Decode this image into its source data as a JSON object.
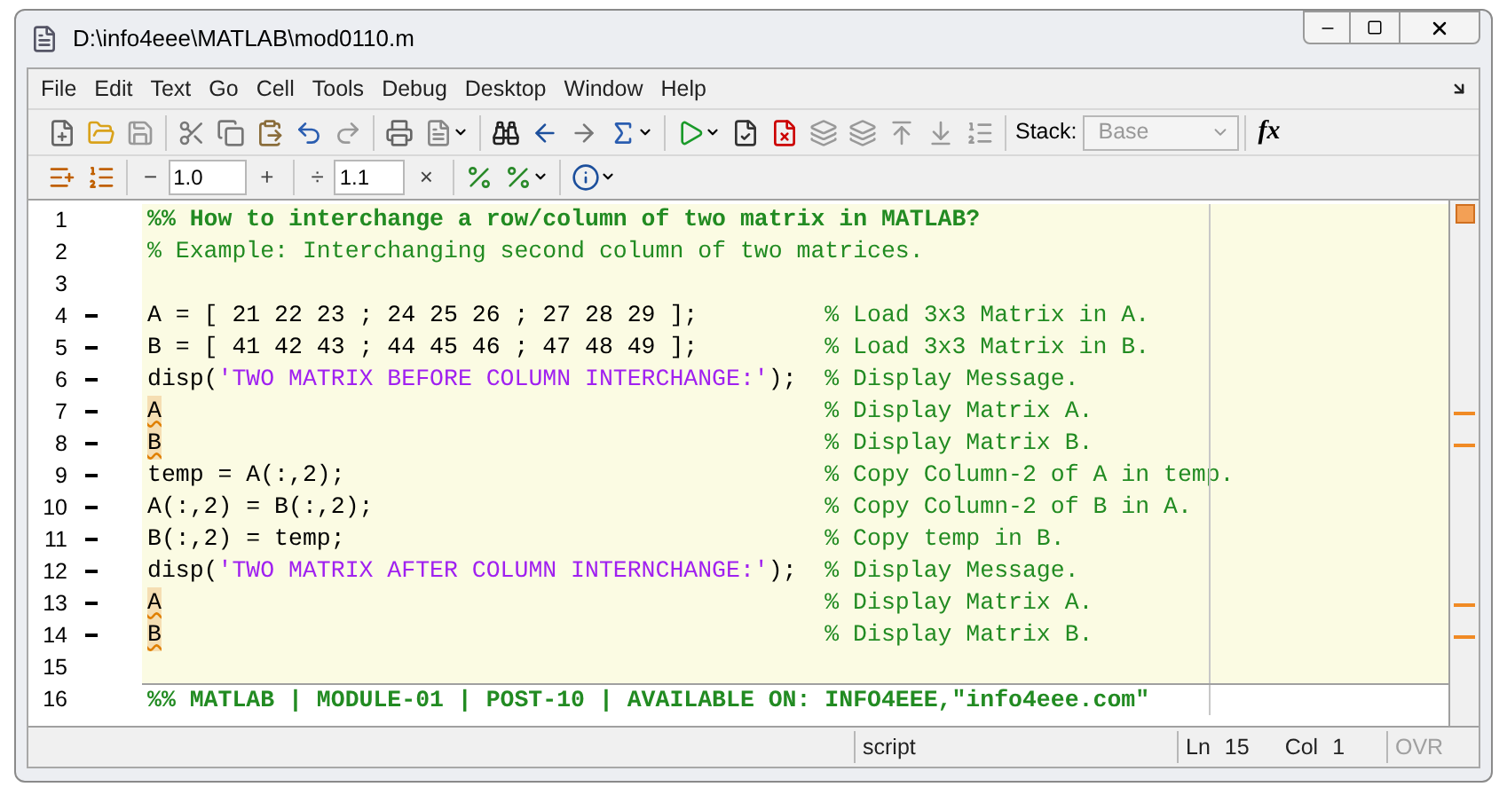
{
  "window": {
    "title": "D:\\info4eee\\MATLAB\\mod0110.m"
  },
  "menu": [
    "File",
    "Edit",
    "Text",
    "Go",
    "Cell",
    "Tools",
    "Debug",
    "Desktop",
    "Window",
    "Help"
  ],
  "toolbar2": {
    "decrement": "−",
    "step_add": "1.0",
    "increment": "+",
    "divide": "÷",
    "step_scale": "1.1",
    "multiply": "×"
  },
  "stack": {
    "label": "Stack:",
    "value": "Base",
    "disabled": true
  },
  "function_button": "fx",
  "editor": {
    "lines": [
      {
        "number": "1",
        "executable": false,
        "current_cell": true,
        "segments": [
          {
            "kind": "cell_title",
            "text": "%% How to interchange a row/column of two matrix in MATLAB?"
          }
        ]
      },
      {
        "number": "2",
        "executable": false,
        "current_cell": true,
        "segments": [
          {
            "kind": "comment",
            "text": "% Example: Interchanging second column of two matrices."
          }
        ]
      },
      {
        "number": "3",
        "executable": false,
        "current_cell": true
      },
      {
        "number": "4",
        "executable": true,
        "current_cell": true,
        "segments": [
          {
            "kind": "code",
            "text": "A = [ 21 22 23 ; 24 25 26 ; 27 28 29 ];"
          },
          {
            "kind": "comment",
            "text": "% Load 3x3 Matrix in A."
          }
        ]
      },
      {
        "number": "5",
        "executable": true,
        "current_cell": true,
        "segments": [
          {
            "kind": "code",
            "text": "B = [ 41 42 43 ; 44 45 46 ; 47 48 49 ];"
          },
          {
            "kind": "comment",
            "text": "% Load 3x3 Matrix in B."
          }
        ]
      },
      {
        "number": "6",
        "executable": true,
        "current_cell": true,
        "segments": [
          {
            "kind": "code",
            "text": "disp("
          },
          {
            "kind": "string",
            "text": "'TWO MATRIX BEFORE COLUMN INTERCHANGE:'"
          },
          {
            "kind": "code",
            "text": ");"
          },
          {
            "kind": "comment",
            "text": "% Display Message."
          }
        ]
      },
      {
        "number": "7",
        "executable": true,
        "current_cell": true,
        "warning": true,
        "segments": [
          {
            "kind": "code",
            "text": "A"
          },
          {
            "kind": "comment",
            "text": "% Display Matrix A."
          }
        ]
      },
      {
        "number": "8",
        "executable": true,
        "current_cell": true,
        "warning": true,
        "segments": [
          {
            "kind": "code",
            "text": "B"
          },
          {
            "kind": "comment",
            "text": "% Display Matrix B."
          }
        ]
      },
      {
        "number": "9",
        "executable": true,
        "current_cell": true,
        "segments": [
          {
            "kind": "code",
            "text": "temp = A(:,2);"
          },
          {
            "kind": "comment",
            "text": "% Copy Column-2 of A in temp."
          }
        ]
      },
      {
        "number": "10",
        "executable": true,
        "current_cell": true,
        "segments": [
          {
            "kind": "code",
            "text": "A(:,2) = B(:,2);"
          },
          {
            "kind": "comment",
            "text": "% Copy Column-2 of B in A."
          }
        ]
      },
      {
        "number": "11",
        "executable": true,
        "current_cell": true,
        "segments": [
          {
            "kind": "code",
            "text": "B(:,2) = temp;"
          },
          {
            "kind": "comment",
            "text": "% Copy temp in B."
          }
        ]
      },
      {
        "number": "12",
        "executable": true,
        "current_cell": true,
        "segments": [
          {
            "kind": "code",
            "text": "disp("
          },
          {
            "kind": "string",
            "text": "'TWO MATRIX AFTER COLUMN INTERNCHANGE:'"
          },
          {
            "kind": "code",
            "text": ");"
          },
          {
            "kind": "comment",
            "text": "% Display Message."
          }
        ]
      },
      {
        "number": "13",
        "executable": true,
        "current_cell": true,
        "warning": true,
        "segments": [
          {
            "kind": "code",
            "text": "A"
          },
          {
            "kind": "comment",
            "text": "% Display Matrix A."
          }
        ]
      },
      {
        "number": "14",
        "executable": true,
        "current_cell": true,
        "warning": true,
        "segments": [
          {
            "kind": "code",
            "text": "B"
          },
          {
            "kind": "comment",
            "text": "% Display Matrix B."
          }
        ]
      },
      {
        "number": "15",
        "executable": false,
        "current_cell": true
      },
      {
        "number": "16",
        "executable": false,
        "current_cell": false,
        "segments": [
          {
            "kind": "cell_title",
            "text": "%% MATLAB | MODULE-01 | POST-10 | AVAILABLE ON: INFO4EEE,\"info4eee.com\""
          }
        ]
      }
    ]
  },
  "status_bar": {
    "file_type": "script",
    "ln_label": "Ln",
    "ln": "15",
    "col_label": "Col",
    "col": "1",
    "ovr": "OVR",
    "ovr_active": false
  }
}
